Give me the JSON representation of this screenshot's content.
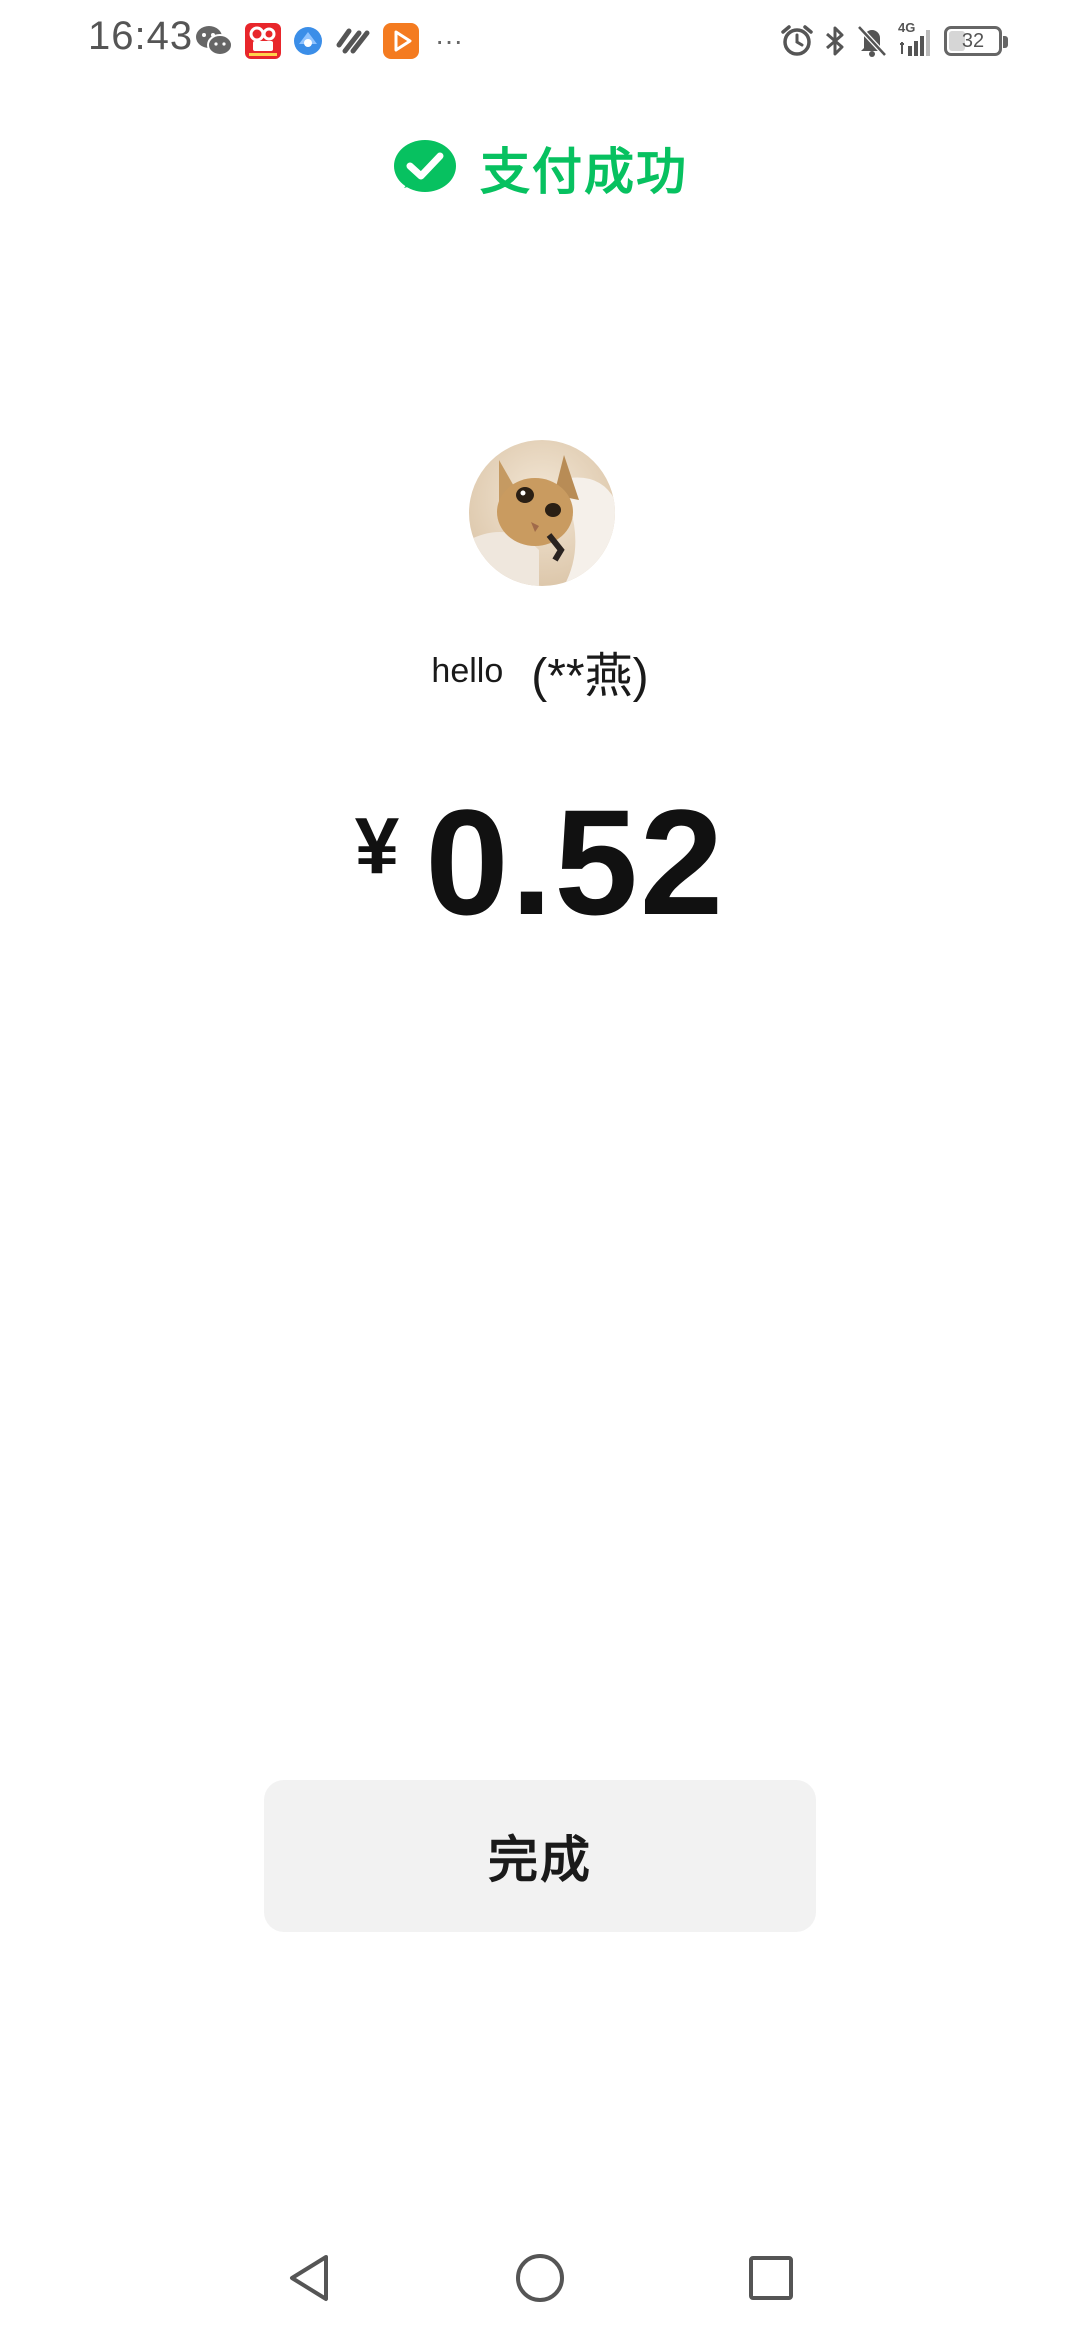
{
  "status_bar": {
    "time": "16:43",
    "more_label": "···",
    "battery_level": "32",
    "network_label": "4G"
  },
  "header": {
    "title": "支付成功",
    "accent_color": "#07c160"
  },
  "payee": {
    "nickname": "hello",
    "masked_name": "(**燕)"
  },
  "amount": {
    "currency_symbol": "¥",
    "value": "0.52"
  },
  "actions": {
    "done_label": "完成"
  },
  "icons": {
    "status_left": [
      "wechat-icon",
      "kuaishou-app-icon",
      "browser-app-icon",
      "sync-app-icon",
      "video-app-icon"
    ],
    "status_right": [
      "alarm-icon",
      "bluetooth-icon",
      "mute-icon",
      "signal-icon",
      "battery-icon"
    ],
    "success": "check-circle-icon",
    "nav": [
      "back-icon",
      "home-icon",
      "recents-icon"
    ]
  }
}
